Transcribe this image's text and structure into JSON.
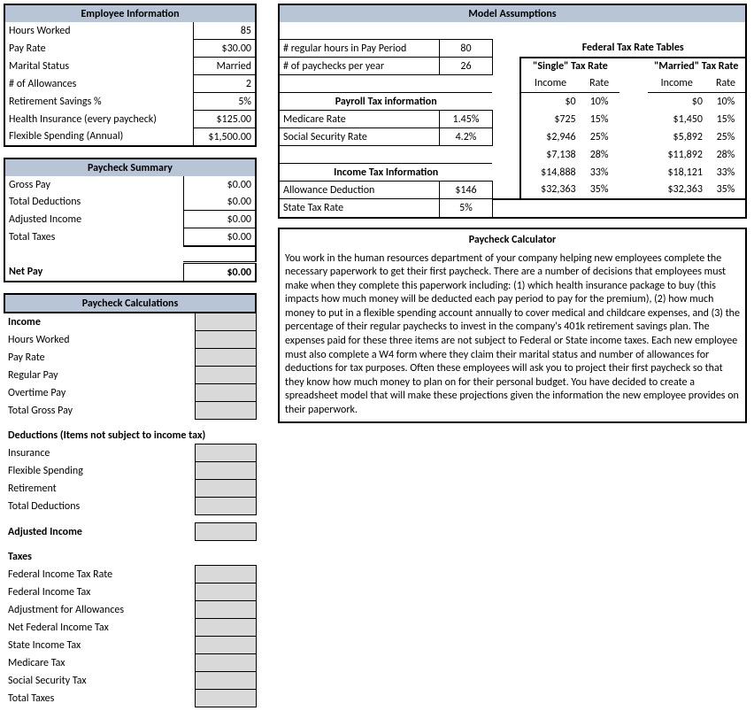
{
  "employee_info": {
    "title": "Employee Information",
    "rows": {
      "hours_worked": {
        "label": "Hours Worked",
        "value": "85"
      },
      "pay_rate": {
        "label": "Pay Rate",
        "value": "$30.00"
      },
      "marital_status": {
        "label": "Marital Status",
        "value": "Married"
      },
      "allowances": {
        "label": "# of Allowances",
        "value": "2"
      },
      "retirement": {
        "label": "Retirement Savings %",
        "value": "5%"
      },
      "health": {
        "label": "Health Insurance (every paycheck)",
        "value": "$125.00"
      },
      "flex": {
        "label": "Flexible Spending (Annual)",
        "value": "$1,500.00"
      }
    }
  },
  "paycheck_summary": {
    "title": "Paycheck Summary",
    "rows": {
      "gross_pay": {
        "label": "Gross Pay",
        "value": "$0.00"
      },
      "total_deductions": {
        "label": "Total Deductions",
        "value": "$0.00"
      },
      "adjusted_income": {
        "label": "Adjusted Income",
        "value": "$0.00"
      },
      "total_taxes": {
        "label": "Total Taxes",
        "value": "$0.00"
      },
      "net_pay": {
        "label": "Net Pay",
        "value": "$0.00"
      }
    }
  },
  "paycheck_calc": {
    "title": "Paycheck Calculations",
    "income": {
      "title": "Income",
      "hours_worked": "Hours Worked",
      "pay_rate": "Pay Rate",
      "regular_pay": "Regular Pay",
      "overtime_pay": "Overtime Pay",
      "total_gross_pay": "Total Gross Pay"
    },
    "deductions": {
      "title": "Deductions (Items not subject to income tax)",
      "insurance": "Insurance",
      "flexible": "Flexible Spending",
      "retirement": "Retirement",
      "total": "Total Deductions"
    },
    "adjusted_income": "Adjusted Income",
    "taxes": {
      "title": "Taxes",
      "fed_rate": "Federal Income Tax Rate",
      "fed_tax": "Federal Income Tax",
      "adj_allow": "Adjustment for Allowances",
      "net_fed": "Net Federal Income Tax",
      "state": "State Income Tax",
      "medicare": "Medicare Tax",
      "ss": "Social Security Tax",
      "total": "Total Taxes"
    }
  },
  "model": {
    "title": "Model Assumptions",
    "reg_hours": {
      "label": "# regular hours in Pay Period",
      "value": "80"
    },
    "paychecks_year": {
      "label": "# of paychecks per year",
      "value": "26"
    },
    "payroll_title": "Payroll Tax information",
    "medicare": {
      "label": "Medicare Rate",
      "value": "1.45%"
    },
    "ss": {
      "label": "Social Security Rate",
      "value": "4.2%"
    },
    "income_tax_title": "Income Tax Information",
    "allow_deduct": {
      "label": "Allowance Deduction",
      "value": "$146"
    },
    "state_rate": {
      "label": "State Tax Rate",
      "value": "5%"
    },
    "fed_tables_title": "Federal Tax Rate Tables",
    "single_title": "\"Single\" Tax Rate",
    "married_title": "\"Married\" Tax Rate",
    "col_income": "Income",
    "col_rate": "Rate",
    "single": [
      {
        "income": "$0",
        "rate": "10%"
      },
      {
        "income": "$725",
        "rate": "15%"
      },
      {
        "income": "$2,946",
        "rate": "25%"
      },
      {
        "income": "$7,138",
        "rate": "28%"
      },
      {
        "income": "$14,888",
        "rate": "33%"
      },
      {
        "income": "$32,363",
        "rate": "35%"
      }
    ],
    "married": [
      {
        "income": "$0",
        "rate": "10%"
      },
      {
        "income": "$1,450",
        "rate": "15%"
      },
      {
        "income": "$5,892",
        "rate": "25%"
      },
      {
        "income": "$11,892",
        "rate": "28%"
      },
      {
        "income": "$18,121",
        "rate": "33%"
      },
      {
        "income": "$32,363",
        "rate": "35%"
      }
    ]
  },
  "calculator": {
    "title": "Paycheck Calculator",
    "body": "You work in the human resources department of your company helping new employees complete the necessary paperwork to get their first paycheck. There are a number of decisions that employees must make when they complete this paperwork including: (1) which health insurance package to buy (this impacts how much money will be deducted each pay period to pay for the premium), (2) how much money to put in a flexible spending account annually to cover medical and childcare expenses, and (3) the percentage of their regular paychecks to invest in the company's 401k retirement savings plan. The expenses paid for these three items are not subject to Federal or State income taxes. Each new employee must also complete a W4 form where they claim their marital status and number of allowances for deductions for tax purposes. Often these employees will ask you to project their first paycheck so that they know how much money to plan on for their personal budget. You have decided to create a spreadsheet model that will make these projections given the information the new employee provides on their paperwork."
  }
}
